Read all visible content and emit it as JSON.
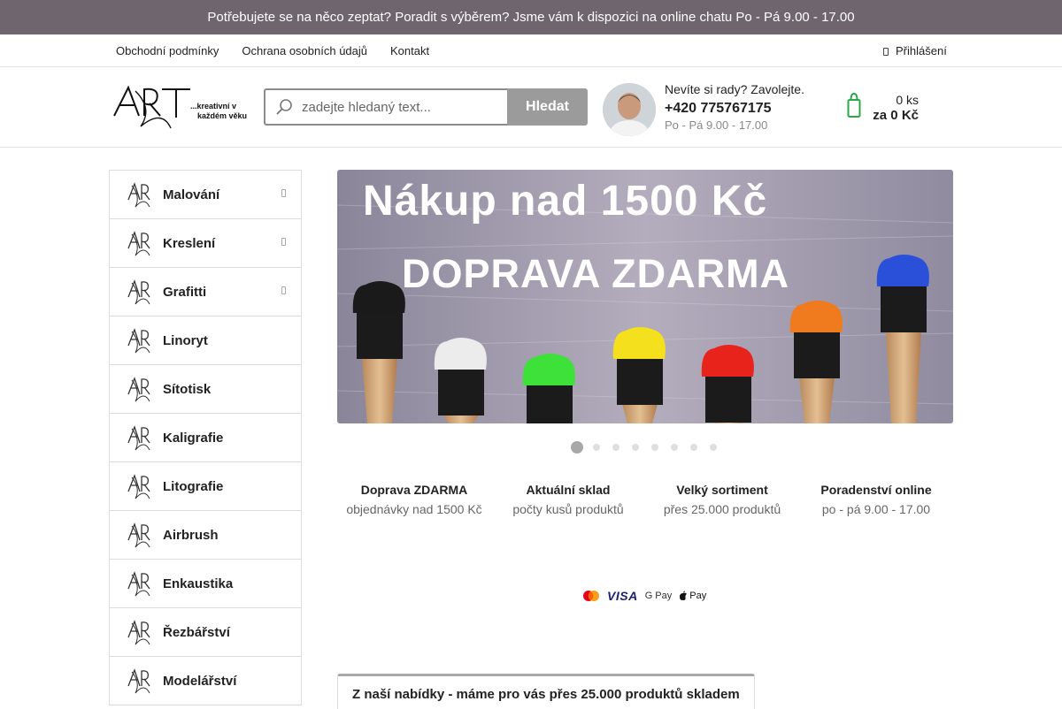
{
  "topbar": {
    "text": "Potřebujete se na něco zeptat? Poradit s výběrem? Jsme vám k dispozici na online chatu Po - Pá 9.00 - 17.00"
  },
  "nav": {
    "links": [
      "Obchodní podmínky",
      "Ochrana osobních údajů",
      "Kontakt"
    ],
    "login": "Přihlášení"
  },
  "logo": {
    "text": "...kreativní v každém věku",
    "line1": "...kreativní v",
    "line2": "každém věku"
  },
  "search": {
    "placeholder": "zadejte hledaný text...",
    "button": "Hledat"
  },
  "contact": {
    "question": "Nevíte si rady? Zavolejte.",
    "phone": "+420 775767175",
    "hours": "Po - Pá 9.00 - 17.00"
  },
  "cart": {
    "count": "0 ks",
    "total": "za 0 Kč",
    "icon": "shopping-bag-icon"
  },
  "categories": [
    {
      "label": "Malování",
      "has_sub": true
    },
    {
      "label": "Kreslení",
      "has_sub": true
    },
    {
      "label": "Grafitti",
      "has_sub": true
    },
    {
      "label": "Linoryt",
      "has_sub": false
    },
    {
      "label": "Sítotisk",
      "has_sub": false
    },
    {
      "label": "Kaligrafie",
      "has_sub": false
    },
    {
      "label": "Litografie",
      "has_sub": false
    },
    {
      "label": "Airbrush",
      "has_sub": false
    },
    {
      "label": "Enkaustika",
      "has_sub": false
    },
    {
      "label": "Řezbářství",
      "has_sub": false
    },
    {
      "label": "Modelářství",
      "has_sub": false
    }
  ],
  "banner": {
    "line1": "Nákup nad 1500 Kč",
    "line2": "DOPRAVA ZDARMA",
    "brush_colors": [
      "#1a1a1a",
      "#ececec",
      "#3ee03a",
      "#f4e01c",
      "#e8231c",
      "#f07a1e",
      "#2a4fd8"
    ]
  },
  "slider": {
    "slides": 8,
    "active": 1
  },
  "benefits": [
    {
      "title": "Doprava ZDARMA",
      "subtitle": "objednávky nad 1500 Kč"
    },
    {
      "title": "Aktuální sklad",
      "subtitle": "počty kusů produktů"
    },
    {
      "title": "Velký sortiment",
      "subtitle": "přes 25.000 produktů"
    },
    {
      "title": "Poradenství online",
      "subtitle": "po - pá 9.00 - 17.00"
    }
  ],
  "payments": {
    "visa": "VISA",
    "gpay": "G Pay",
    "applepay": "Pay"
  },
  "tab": {
    "label": "Z naší nabídky - máme pro vás přes 25.000 produktů skladem"
  }
}
